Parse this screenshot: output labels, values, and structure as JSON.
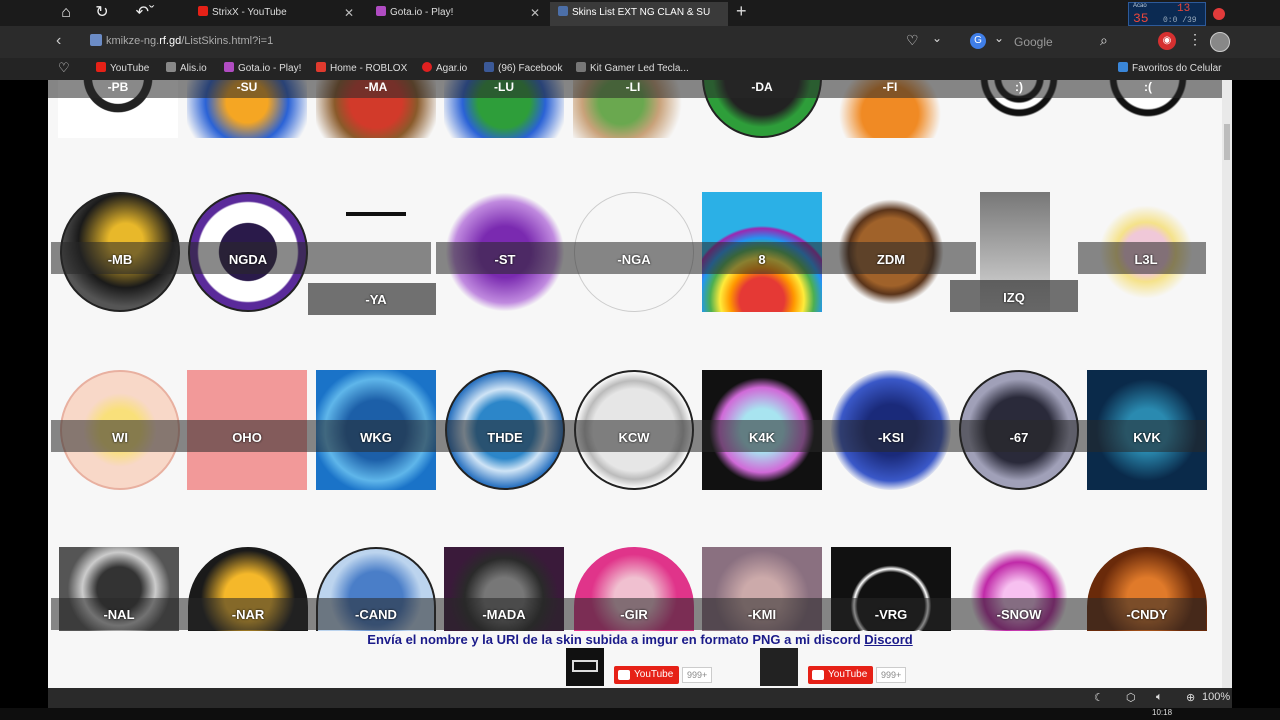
{
  "browser": {
    "tabs": [
      {
        "label": "StrixX - YouTube",
        "fav": "#e62117"
      },
      {
        "label": "Gota.io - Play!",
        "fav": "#b04cc2"
      },
      {
        "label": "Skins List EXT NG CLAN & SU",
        "fav": "#4c6fa8"
      }
    ],
    "url_prefix": "kmikze-ng.",
    "url_domain": "rf.gd",
    "url_path": "/ListSkins.html?i=1",
    "search_engine": "Google",
    "sysbox": {
      "a": "Acao",
      "b": "35",
      "c": "13",
      "d": "0:0 /39"
    }
  },
  "bookmarks": [
    {
      "label": "YouTube",
      "color": "#e62117"
    },
    {
      "label": "Alis.io",
      "color": "#888888"
    },
    {
      "label": "Gota.io - Play!",
      "color": "#b04cc2"
    },
    {
      "label": "Home - ROBLOX",
      "color": "#e03a2e"
    },
    {
      "label": "Agar.io",
      "color": "#e02020"
    },
    {
      "label": "(96) Facebook",
      "color": "#3b5998"
    },
    {
      "label": "Kit Gamer Led Tecla...",
      "color": "#777777"
    },
    {
      "label": "Favoritos do Celular",
      "color": "#3a86d8"
    }
  ],
  "skins": {
    "row0": [
      "-PB",
      "-SU",
      "-MA",
      "-LU",
      "-LI",
      "-DA",
      "-FI",
      ":)",
      ":("
    ],
    "row1": [
      "-MB",
      "NGDA",
      "-YA",
      "-ST",
      "-NGA",
      "8",
      "ZDM",
      "IZQ",
      "L3L"
    ],
    "row2": [
      "WI",
      "OHO",
      "WKG",
      "THDE",
      "KCW",
      "K4K",
      "-KSI",
      "-67",
      "KVK"
    ],
    "row3": [
      "-NAL",
      "-NAR",
      "-CAND",
      "-MADA",
      "-GIR",
      "-KMI",
      "-VRG",
      "-SNOW",
      "-CNDY"
    ]
  },
  "notice": {
    "text": "Envía el nombre y la URl de la skin subida a imgur en formato PNG a mi discord ",
    "link": "Discord"
  },
  "youtube": {
    "label": "YouTube",
    "count": "999+"
  },
  "status": {
    "zoom": "100%"
  },
  "taskbar": {
    "clock": "10:18"
  }
}
